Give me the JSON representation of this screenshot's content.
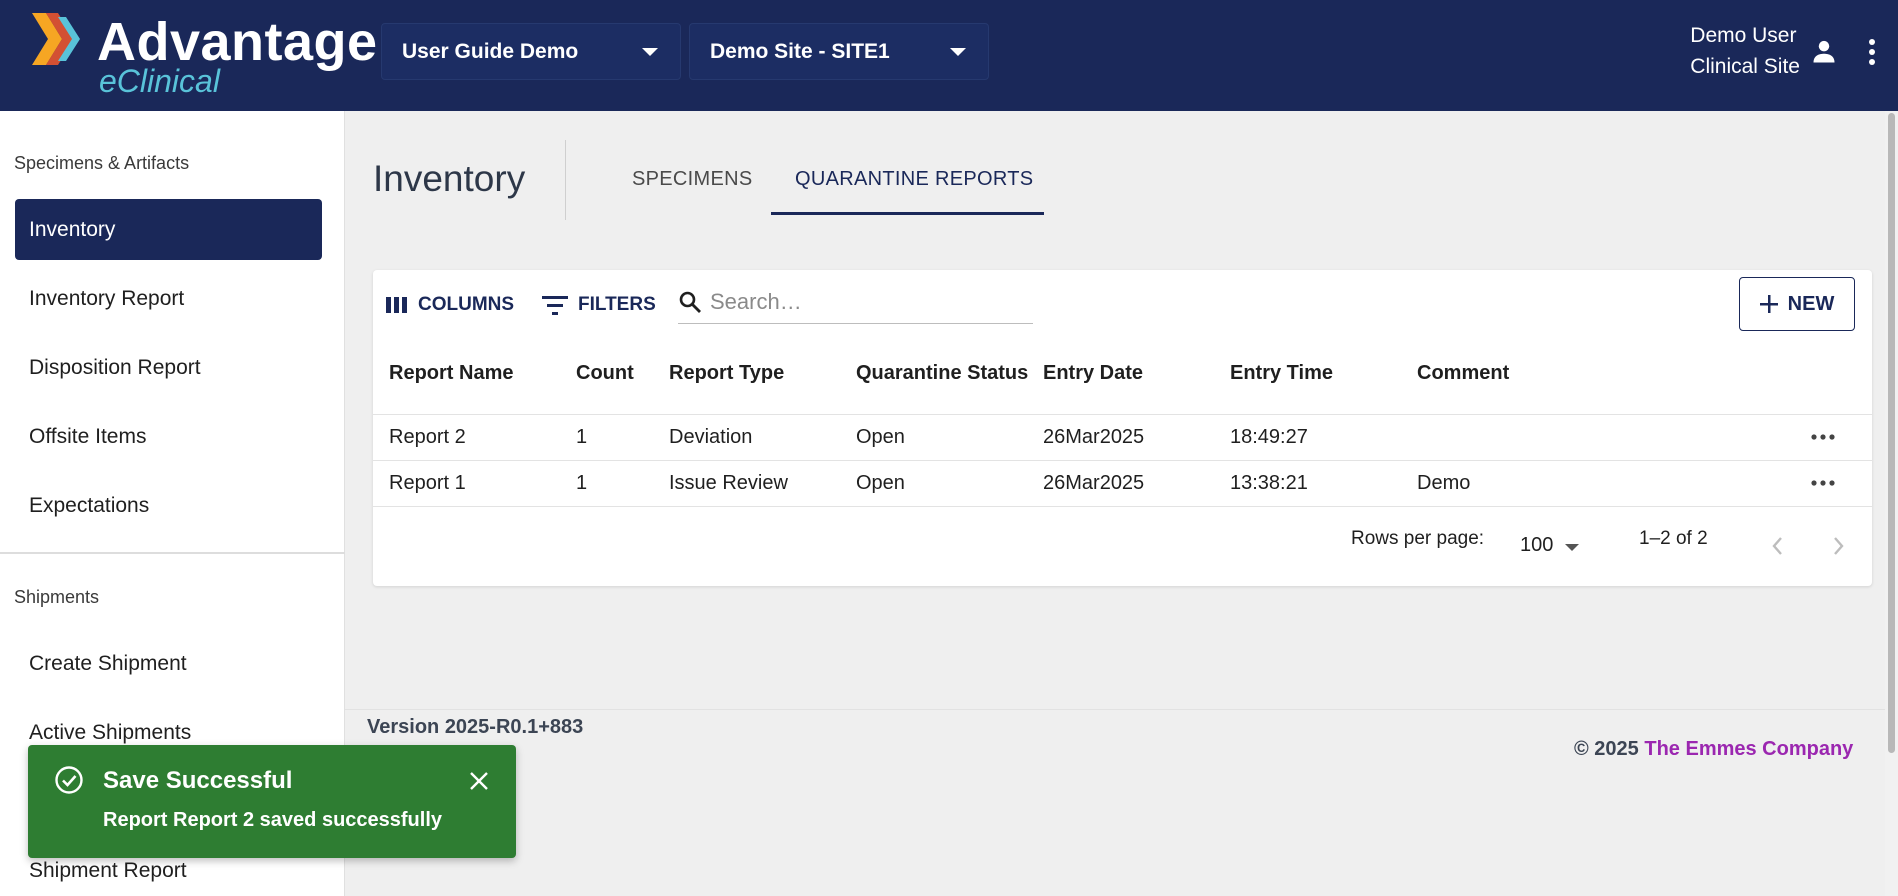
{
  "header": {
    "logo_title": "Advantage",
    "logo_subtitle": "eClinical",
    "study_select": "User Guide Demo",
    "site_select": "Demo Site - SITE1",
    "user_name": "Demo User",
    "user_role": "Clinical Site"
  },
  "sidebar": {
    "section1": "Specimens & Artifacts",
    "items1": [
      {
        "label": "Inventory",
        "active": true
      },
      {
        "label": "Inventory Report"
      },
      {
        "label": "Disposition Report"
      },
      {
        "label": "Offsite Items"
      },
      {
        "label": "Expectations"
      }
    ],
    "section2": "Shipments",
    "items2": [
      {
        "label": "Create Shipment"
      },
      {
        "label": "Active Shipments"
      },
      {
        "label": "Shipment Report"
      }
    ]
  },
  "main": {
    "title": "Inventory",
    "tabs": [
      {
        "label": "SPECIMENS",
        "active": false
      },
      {
        "label": "QUARANTINE REPORTS",
        "active": true
      }
    ],
    "toolbar": {
      "columns": "COLUMNS",
      "filters": "FILTERS",
      "search_placeholder": "Search…",
      "new": "NEW"
    },
    "table": {
      "headers": [
        "Report Name",
        "Count",
        "Report Type",
        "Quarantine Status",
        "Entry Date",
        "Entry Time",
        "Comment"
      ],
      "rows": [
        [
          "Report 2",
          "1",
          "Deviation",
          "Open",
          "26Mar2025",
          "18:49:27",
          ""
        ],
        [
          "Report 1",
          "1",
          "Issue Review",
          "Open",
          "26Mar2025",
          "13:38:21",
          "Demo"
        ]
      ]
    },
    "pagination": {
      "rows_label": "Rows per page:",
      "rows_value": "100",
      "range": "1–2 of 2"
    }
  },
  "footer": {
    "version": "Version 2025-R0.1+883",
    "copyright": "© 2025",
    "company": "The Emmes Company"
  },
  "toast": {
    "title": "Save Successful",
    "message": "Report Report 2 saved successfully"
  },
  "colors": {
    "brand_navy": "#1a2859",
    "accent_teal": "#59c3d9",
    "success_green": "#2e7d32",
    "company_purple": "#9b27b0"
  }
}
